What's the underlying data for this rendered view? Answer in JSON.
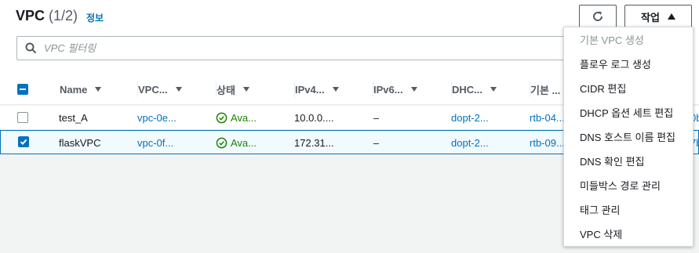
{
  "header": {
    "title": "VPC",
    "count": "(1/2)",
    "info_link": "정보",
    "actions_label": "작업"
  },
  "search": {
    "placeholder": "VPC 필터링"
  },
  "table": {
    "columns": [
      "Name",
      "VPC...",
      "상태",
      "IPv4...",
      "IPv6...",
      "DHC...",
      "기본 ..."
    ],
    "rows": [
      {
        "name": "test_A",
        "vpc_id": "vpc-0e...",
        "state": "Ava...",
        "ipv4": "10.0.0....",
        "ipv6": "–",
        "dhcp": "dopt-2...",
        "route_table": "rtb-04...",
        "extra": "0b",
        "selected": false
      },
      {
        "name": "flaskVPC",
        "vpc_id": "vpc-0f...",
        "state": "Ava...",
        "ipv4": "172.31...",
        "ipv6": "–",
        "dhcp": "dopt-2...",
        "route_table": "rtb-09...",
        "extra": "7b",
        "selected": true
      }
    ]
  },
  "actions_menu": {
    "items": [
      {
        "label": "기본 VPC 생성",
        "disabled": true
      },
      {
        "label": "플로우 로그 생성",
        "disabled": false
      },
      {
        "label": "CIDR 편집",
        "disabled": false
      },
      {
        "label": "DHCP 옵션 세트 편집",
        "disabled": false
      },
      {
        "label": "DNS 호스트 이름 편집",
        "disabled": false
      },
      {
        "label": "DNS 확인 편집",
        "disabled": false
      },
      {
        "label": "미들박스 경로 관리",
        "disabled": false
      },
      {
        "label": "태그 관리",
        "disabled": false
      },
      {
        "label": "VPC 삭제",
        "disabled": false
      }
    ]
  },
  "colors": {
    "link": "#0073bb",
    "success": "#1d8102",
    "selected_row_bg": "#f1faff"
  }
}
